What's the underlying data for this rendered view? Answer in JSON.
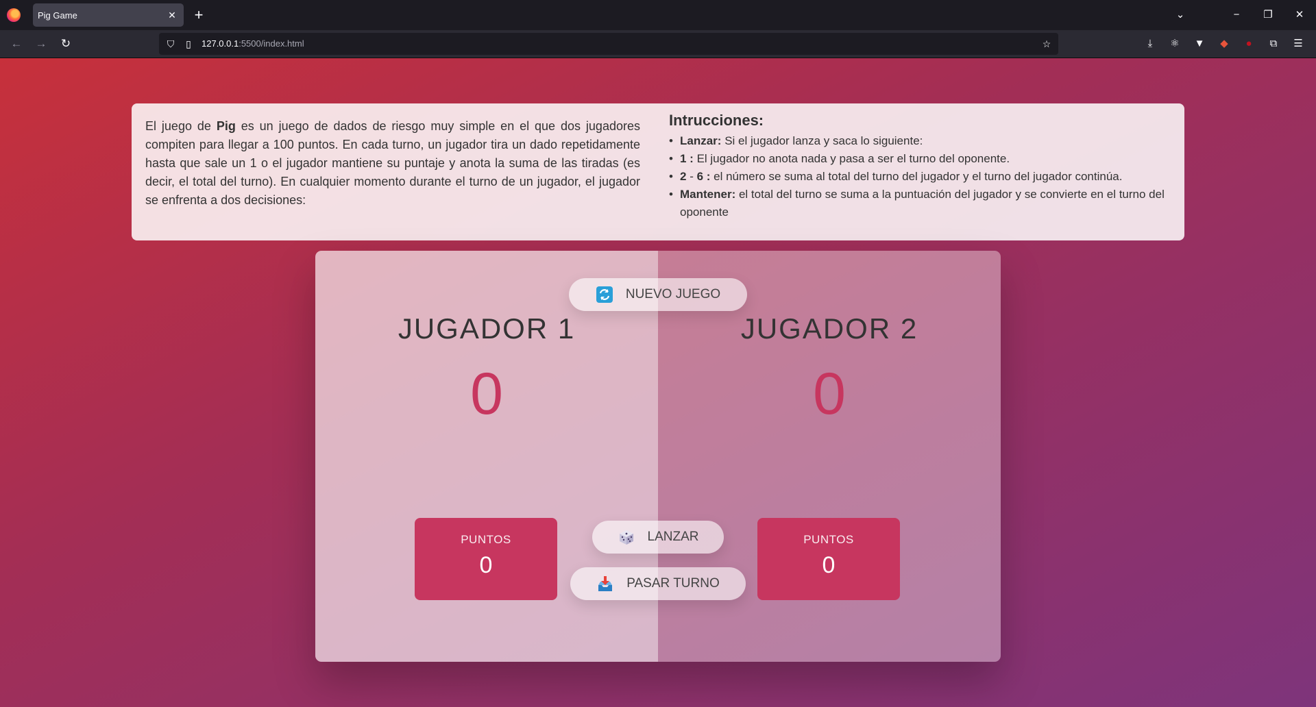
{
  "browser": {
    "tab_title": "Pig Game",
    "url_host": "127.0.0.1",
    "url_rest": ":5500/index.html"
  },
  "instructions": {
    "intro_before_bold": "El juego de ",
    "intro_bold": "Pig",
    "intro_after_bold": " es un juego de dados de riesgo muy simple en el que dos jugadores compiten para llegar a 100 puntos. En cada turno, un jugador tira un dado repetidamente hasta que sale un 1 o el jugador mantiene su puntaje y anota la suma de las tiradas (es decir, el total del turno). En cualquier momento durante el turno de un jugador, el jugador se enfrenta a dos decisiones:",
    "title": "Intrucciones:",
    "items": [
      {
        "bold": "Lanzar:",
        "text": " Si el jugador lanza y saca lo siguiente:"
      },
      {
        "bold": "1 :",
        "text": " El jugador no anota nada y pasa a ser el turno del oponente."
      },
      {
        "bold": "2",
        "mid": " - ",
        "bold2": "6 :",
        "text": " el número se suma al total del turno del jugador y el turno del jugador continúa."
      },
      {
        "bold": "Mantener:",
        "text": " el total del turno se suma a la puntuación del jugador y se convierte en el turno del oponente"
      }
    ]
  },
  "game": {
    "player1": {
      "name": "JUGADOR 1",
      "score": "0",
      "current_label": "PUNTOS",
      "current_score": "0"
    },
    "player2": {
      "name": "JUGADOR 2",
      "score": "0",
      "current_label": "PUNTOS",
      "current_score": "0"
    },
    "buttons": {
      "new_game": "NUEVO JUEGO",
      "roll": "LANZAR",
      "hold": "PASAR TURNO"
    }
  },
  "colors": {
    "accent": "#c7365f",
    "bg_top_left": "#c7303b",
    "bg_bottom_right": "#7e347b"
  }
}
